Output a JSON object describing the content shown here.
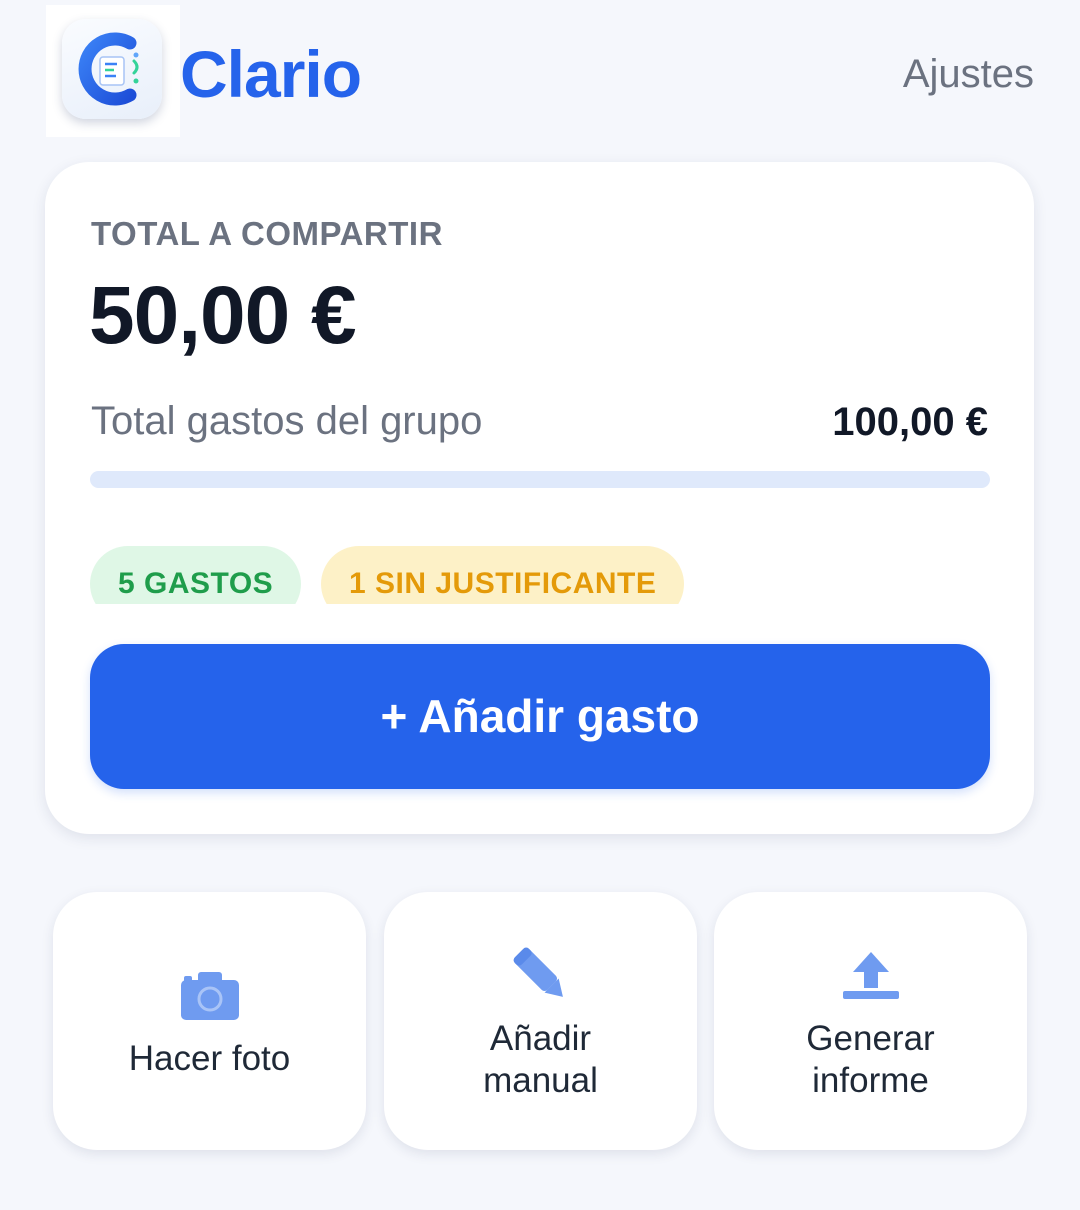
{
  "header": {
    "brand_name": "Clario",
    "settings_label": "Ajustes"
  },
  "summary": {
    "total_label": "TOTAL A COMPARTIR",
    "total_amount": "50,00 €",
    "group_label": "Total gastos del grupo",
    "group_amount": "100,00 €",
    "progress_fraction": 0,
    "badges": {
      "expenses": "5 GASTOS",
      "no_receipt": "1 SIN JUSTIFICANTE"
    },
    "add_button_label": "+ Añadir gasto"
  },
  "actions": [
    {
      "label": "Hacer foto",
      "icon": "camera-icon"
    },
    {
      "label": "Añadir\nmanual",
      "icon": "pencil-icon"
    },
    {
      "label": "Generar\ninforme",
      "icon": "upload-icon"
    }
  ],
  "colors": {
    "accent": "#2563eb",
    "expenses_badge_bg": "#dff7e6",
    "expenses_badge_text": "#1f9d4b",
    "no_receipt_badge_bg": "#fdf1c7",
    "no_receipt_badge_text": "#e49a09",
    "icon_tint": "#6f9bf0"
  }
}
